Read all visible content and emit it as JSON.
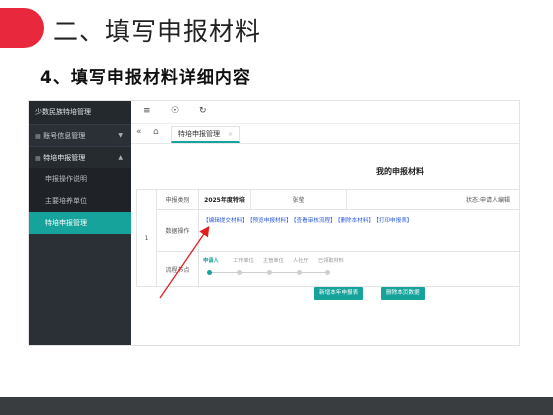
{
  "slide": {
    "title": "二、填写申报材料",
    "subtitle": "4、填写申报材料详细内容"
  },
  "colors": {
    "accent_red": "#e8283c",
    "accent_teal": "#16a39b",
    "sidebar_bg": "#2b3036",
    "link_blue": "#2a5bd7",
    "annotation_red": "#e02020"
  },
  "sidebar": {
    "brand": "少数民族特培管理",
    "groups": [
      {
        "label": "账号信息管理",
        "icon": "grid-icon",
        "expanded": false
      },
      {
        "label": "特培申报管理",
        "icon": "grid-icon",
        "expanded": true
      }
    ],
    "items": [
      {
        "label": "申报操作说明",
        "active": false
      },
      {
        "label": "主要培养单位",
        "active": false
      },
      {
        "label": "特培申报管理",
        "active": true
      }
    ]
  },
  "topbar": {
    "icons": [
      "menu-icon",
      "globe-icon",
      "refresh-icon"
    ]
  },
  "tabs": {
    "active_label": "特培申报管理"
  },
  "main": {
    "title": "我的申报材料",
    "row": {
      "index": "1",
      "type_label": "申报类别",
      "year": "2025年度特培",
      "name": "张莹",
      "status": "状态:申请人编辑",
      "ops_label": "数据操作",
      "ops": [
        "【编辑提交材料】",
        "【预览申报材料】",
        "【查看审核流程】",
        "【删除本材料】",
        "【打印申报表】"
      ],
      "flow_label": "流程节点",
      "flow_steps": [
        "申请人",
        "工作单位",
        "主管单位",
        "人社厅",
        "已领取材料"
      ],
      "flow_active_index": 0
    },
    "buttons": {
      "add": "新增本年申报表",
      "delete": "删除本页数据"
    }
  }
}
